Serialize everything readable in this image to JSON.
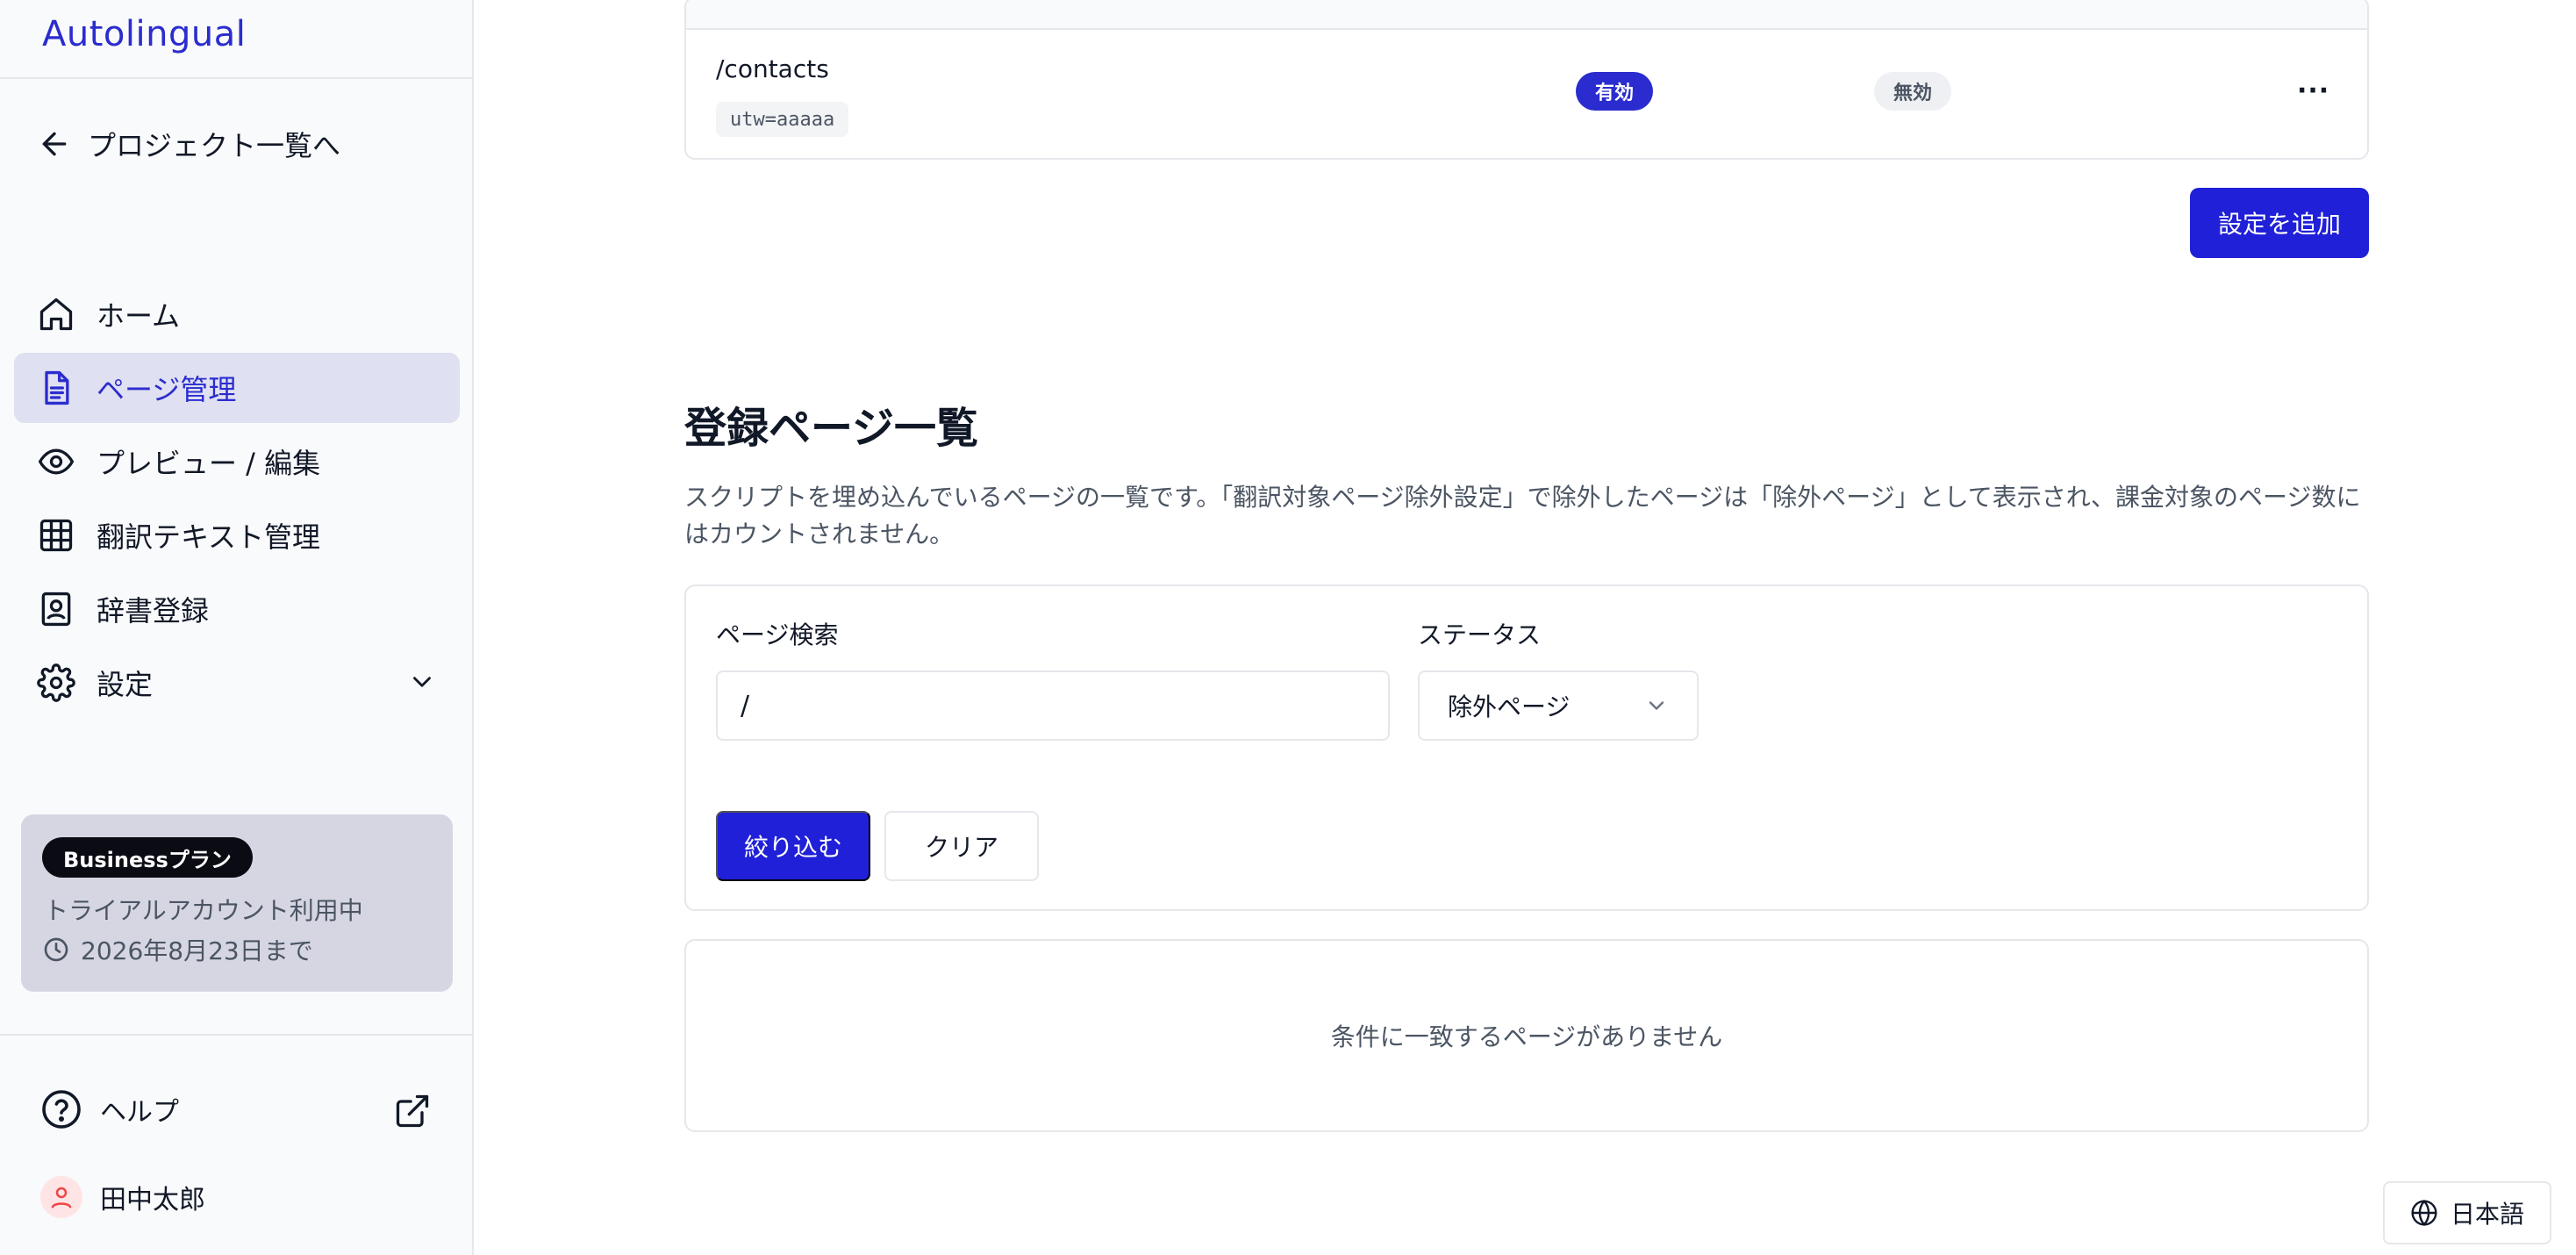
{
  "app": {
    "name": "Autolingual"
  },
  "sidebar": {
    "back_label": "プロジェクト一覧へ",
    "items": [
      {
        "label": "ホーム",
        "icon": "home-icon",
        "active": false
      },
      {
        "label": "ページ管理",
        "icon": "document-icon",
        "active": true
      },
      {
        "label": "プレビュー / 編集",
        "icon": "eye-icon",
        "active": false
      },
      {
        "label": "翻訳テキスト管理",
        "icon": "table-icon",
        "active": false
      },
      {
        "label": "辞書登録",
        "icon": "contact-book-icon",
        "active": false
      },
      {
        "label": "設定",
        "icon": "gear-icon",
        "active": false,
        "expandable": true
      }
    ],
    "plan": {
      "badge": "Businessプラン",
      "status": "トライアルアカウント利用中",
      "expiry": "2026年8月23日まで"
    },
    "help_label": "ヘルプ",
    "user_name": "田中太郎"
  },
  "exclusion_table": {
    "rows": [
      {
        "path": "/contacts",
        "query": "utw=aaaaa",
        "status_a": "有効",
        "status_b": "無効",
        "menu": "···"
      }
    ]
  },
  "add_setting_label": "設定を追加",
  "registered_pages": {
    "title": "登録ページ一覧",
    "description": "スクリプトを埋め込んでいるページの一覧です。「翻訳対象ページ除外設定」で除外したページは「除外ページ」として表示され、課金対象のページ数にはカウントされません。",
    "filter": {
      "search_label": "ページ検索",
      "search_value": "/",
      "status_label": "ステータス",
      "status_value": "除外ページ",
      "apply_label": "絞り込む",
      "clear_label": "クリア"
    },
    "empty_message": "条件に一致するページがありません"
  },
  "language": {
    "label": "日本語"
  },
  "colors": {
    "accent": "#2020d8",
    "brand_text": "#2b2ccf",
    "active_bg": "#dfe0f1",
    "plan_bg": "#d6d6e3"
  }
}
